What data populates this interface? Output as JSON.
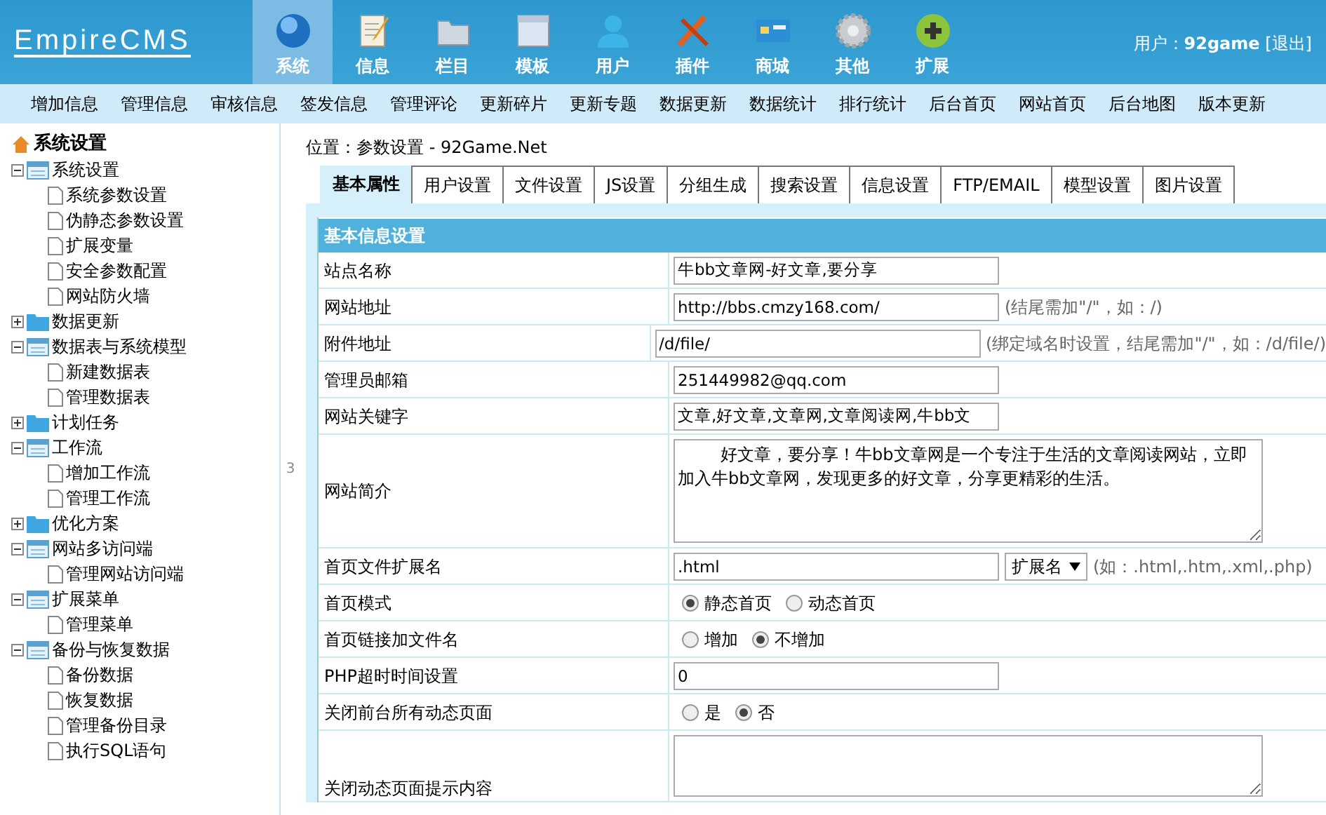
{
  "header": {
    "logo": "EmpireCMS",
    "nav": [
      {
        "label": "系统",
        "selected": true
      },
      {
        "label": "信息",
        "selected": false
      },
      {
        "label": "栏目",
        "selected": false
      },
      {
        "label": "模板",
        "selected": false
      },
      {
        "label": "用户",
        "selected": false
      },
      {
        "label": "插件",
        "selected": false
      },
      {
        "label": "商城",
        "selected": false
      },
      {
        "label": "其他",
        "selected": false
      },
      {
        "label": "扩展",
        "selected": false
      }
    ],
    "user_label": "用户：",
    "user_name": "92game",
    "logout": "[退出]"
  },
  "menu_bar": [
    "增加信息",
    "管理信息",
    "审核信息",
    "签发信息",
    "管理评论",
    "更新碎片",
    "更新专题",
    "数据更新",
    "数据统计",
    "排行统计",
    "后台首页",
    "网站首页",
    "后台地图",
    "版本更新"
  ],
  "sidebar": {
    "title": "系统设置",
    "items": [
      {
        "label": "系统设置",
        "expanded": true,
        "children": [
          {
            "label": "系统参数设置"
          },
          {
            "label": "伪静态参数设置"
          },
          {
            "label": "扩展变量"
          },
          {
            "label": "安全参数配置"
          },
          {
            "label": "网站防火墙"
          }
        ]
      },
      {
        "label": "数据更新",
        "expanded": false
      },
      {
        "label": "数据表与系统模型",
        "expanded": true,
        "children": [
          {
            "label": "新建数据表"
          },
          {
            "label": "管理数据表"
          }
        ]
      },
      {
        "label": "计划任务",
        "expanded": false
      },
      {
        "label": "工作流",
        "expanded": true,
        "children": [
          {
            "label": "增加工作流"
          },
          {
            "label": "管理工作流"
          }
        ]
      },
      {
        "label": "优化方案",
        "expanded": false
      },
      {
        "label": "网站多访问端",
        "expanded": true,
        "children": [
          {
            "label": "管理网站访问端"
          }
        ]
      },
      {
        "label": "扩展菜单",
        "expanded": true,
        "children": [
          {
            "label": "管理菜单"
          }
        ]
      },
      {
        "label": "备份与恢复数据",
        "expanded": true,
        "children": [
          {
            "label": "备份数据"
          },
          {
            "label": "恢复数据"
          },
          {
            "label": "管理备份目录"
          },
          {
            "label": "执行SQL语句"
          }
        ]
      }
    ]
  },
  "splitter": "3",
  "breadcrumb": "位置：参数设置 - 92Game.Net",
  "tabs": [
    {
      "label": "基本属性",
      "selected": true
    },
    {
      "label": "用户设置",
      "selected": false
    },
    {
      "label": "文件设置",
      "selected": false
    },
    {
      "label": "JS设置",
      "selected": false
    },
    {
      "label": "分组生成",
      "selected": false
    },
    {
      "label": "搜索设置",
      "selected": false
    },
    {
      "label": "信息设置",
      "selected": false
    },
    {
      "label": "FTP/EMAIL",
      "selected": false
    },
    {
      "label": "模型设置",
      "selected": false
    },
    {
      "label": "图片设置",
      "selected": false
    }
  ],
  "form": {
    "heading": "基本信息设置",
    "rows": [
      {
        "kind": "text",
        "label": "站点名称",
        "value": "牛bb文章网-好文章,要分享"
      },
      {
        "kind": "text",
        "label": "网站地址",
        "value": "http://bbs.cmzy168.com/",
        "hint": "(结尾需加\"/\"，如：/)"
      },
      {
        "kind": "text",
        "label": "附件地址",
        "value": "/d/file/",
        "hint": "(绑定域名时设置，结尾需加\"/\"，如：/d/file/)"
      },
      {
        "kind": "text",
        "label": "管理员邮箱",
        "value": "251449982@qq.com"
      },
      {
        "kind": "text",
        "label": "网站关键字",
        "value": "文章,好文章,文章网,文章阅读网,牛bb文"
      },
      {
        "kind": "textarea",
        "label": "网站简介",
        "value": "        好文章，要分享！牛bb文章网是一个专注于生活的文章阅读网站，立即加入牛bb文章网，发现更多的好文章，分享更精彩的生活。"
      },
      {
        "kind": "select",
        "label": "首页文件扩展名",
        "value": ".html",
        "select": "扩展名",
        "hint": "(如：.html,.htm,.xml,.php)"
      },
      {
        "kind": "radio",
        "label": "首页模式",
        "options": [
          {
            "label": "静态首页",
            "selected": true
          },
          {
            "label": "动态首页",
            "selected": false
          }
        ]
      },
      {
        "kind": "radio",
        "label": "首页链接加文件名",
        "options": [
          {
            "label": "增加",
            "selected": false
          },
          {
            "label": "不增加",
            "selected": true
          }
        ]
      },
      {
        "kind": "text",
        "label": "PHP超时时间设置",
        "value": "0"
      },
      {
        "kind": "radio",
        "label": "关闭前台所有动态页面",
        "options": [
          {
            "label": "是",
            "selected": false
          },
          {
            "label": "否",
            "selected": true
          }
        ]
      },
      {
        "kind": "textarea",
        "label": "关闭动态页面提示内容",
        "value": ""
      }
    ]
  }
}
